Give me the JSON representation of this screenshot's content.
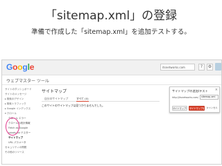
{
  "slide": {
    "title": "「sitemap.xml」の登録",
    "subtitle": "準備で作成した「sitemap.xml」を追加テストする。"
  },
  "screenshot": {
    "header": {
      "logo": "Google",
      "site_value": "itsnetworks.com",
      "buttons": [
        "?",
        "⚙"
      ]
    },
    "app_title": "ウェブマスター ツール",
    "sidebar": {
      "items": [
        {
          "label": "サイトのダッシュボード",
          "level": 0
        },
        {
          "label": "サイトのメッセージ",
          "level": 0
        },
        {
          "label": "検索のデザイン",
          "level": 0
        },
        {
          "label": "検索トラフィック",
          "level": 0
        },
        {
          "label": "Google インデックス",
          "level": 0
        },
        {
          "label": "クロール",
          "level": 0
        },
        {
          "label": "クロール エラー",
          "level": 1
        },
        {
          "label": "クロールの統計情報",
          "level": 1
        },
        {
          "label": "Fetch as Google",
          "level": 1
        },
        {
          "label": "robots.txt テスター",
          "level": 1
        },
        {
          "label": "サイトマップ",
          "level": 1
        },
        {
          "label": "URL パラメータ",
          "level": 1
        },
        {
          "label": "セキュリティの問題",
          "level": 0
        },
        {
          "label": "その他のリソース",
          "level": 0
        }
      ]
    },
    "main": {
      "heading": "サイトマップ",
      "tabs": [
        "自分のサイトマップ",
        "すべて (0)"
      ],
      "empty_message": "このサイトのサイトマップは見つかりませんでした。"
    },
    "dialog": {
      "title": "サイトマップの追加/テスト",
      "close": "×",
      "url_prefix": "http://itsnetworks.com/",
      "input_value": "sitemap.xml",
      "buttons": [
        "サイトマップを送信",
        "サイトマップをテスト",
        "キャンセル"
      ]
    },
    "colors": {
      "accent_red": "#d9452f",
      "highlight": "#e03a8c"
    }
  }
}
